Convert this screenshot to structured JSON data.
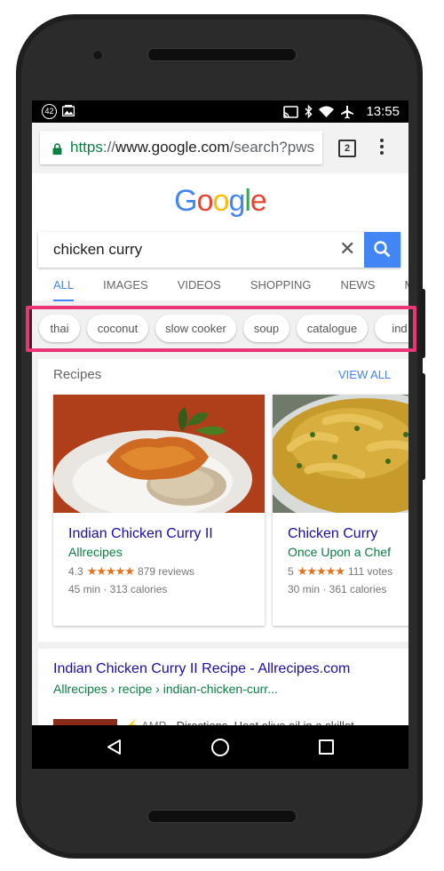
{
  "status_bar": {
    "notification_count": "42",
    "time": "13:55"
  },
  "browser": {
    "url_scheme": "https",
    "url_sep": "://",
    "url_host": "www.google.com",
    "url_path": "/search?pws",
    "tab_count": "2"
  },
  "google": {
    "logo_letters": [
      "G",
      "o",
      "o",
      "g",
      "l",
      "e"
    ],
    "logo_colors": [
      "#4285f4",
      "#ea4335",
      "#fbbc05",
      "#4285f4",
      "#34a853",
      "#ea4335"
    ],
    "query": "chicken curry",
    "clear_glyph": "✕"
  },
  "tabs": [
    "ALL",
    "IMAGES",
    "VIDEOS",
    "SHOPPING",
    "NEWS",
    "MA"
  ],
  "chips": [
    "thai",
    "coconut",
    "slow cooker",
    "soup",
    "catalogue",
    "ind"
  ],
  "recipes": {
    "heading": "Recipes",
    "view_all": "VIEW ALL",
    "cards": [
      {
        "title": "Indian Chicken Curry II",
        "source": "Allrecipes",
        "rating": "4.3",
        "stars": "★★★★★",
        "reviews": "879 reviews",
        "meta": "45 min · 313 calories"
      },
      {
        "title": "Chicken Curry",
        "source": "Once Upon a Chef",
        "rating": "5",
        "stars": "★★★★★",
        "reviews": "111 votes",
        "meta": "30 min · 361 calories"
      }
    ]
  },
  "result": {
    "title": "Indian Chicken Curry II Recipe - Allrecipes.com",
    "breadcrumb": "Allrecipes › recipe › indian-chicken-curr...",
    "amp_label": "AMP",
    "snippet": "· Directions. Heat olive oil in a skillet"
  },
  "colors": {
    "link": "#1a0dab",
    "url_green": "#0b8043",
    "accent_blue": "#4285f4",
    "highlight": "#ea3577",
    "star_orange": "#e7711b"
  }
}
